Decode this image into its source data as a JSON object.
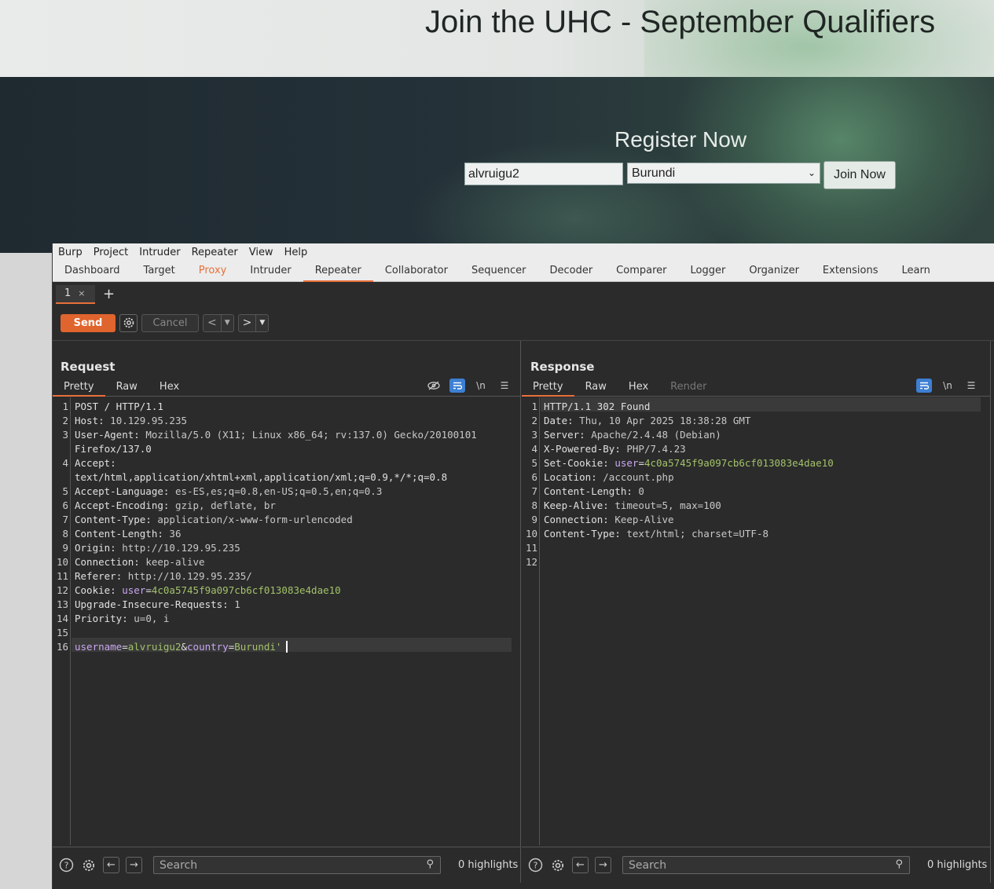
{
  "web": {
    "title": "Join the UHC - September Qualifiers",
    "register_heading": "Register Now",
    "username_value": "alvruigu2",
    "country_selected": "Burundi",
    "join_label": "Join Now"
  },
  "burp": {
    "menu": [
      "Burp",
      "Project",
      "Intruder",
      "Repeater",
      "View",
      "Help"
    ],
    "tabs": [
      "Dashboard",
      "Target",
      "Proxy",
      "Intruder",
      "Repeater",
      "Collaborator",
      "Sequencer",
      "Decoder",
      "Comparer",
      "Logger",
      "Organizer",
      "Extensions",
      "Learn"
    ],
    "active_tab": "Repeater",
    "repeater_tab": "1",
    "repeater_tab_close": "×",
    "add_tab": "+",
    "toolbar": {
      "send": "Send",
      "cancel": "Cancel"
    },
    "request": {
      "title": "Request",
      "view_tabs": [
        "Pretty",
        "Raw",
        "Hex"
      ],
      "lines": [
        "POST / HTTP/1.1",
        "Host: 10.129.95.235",
        "User-Agent: Mozilla/5.0 (X11; Linux x86_64; rv:137.0) Gecko/20100101",
        "Firefox/137.0",
        "Accept:",
        "text/html,application/xhtml+xml,application/xml;q=0.9,*/*;q=0.8",
        "Accept-Language: es-ES,es;q=0.8,en-US;q=0.5,en;q=0.3",
        "Accept-Encoding: gzip, deflate, br",
        "Content-Type: application/x-www-form-urlencoded",
        "Content-Length: 36",
        "Origin: http://10.129.95.235",
        "Connection: keep-alive",
        "Referer: http://10.129.95.235/",
        "Cookie: user=4c0a5745f9a097cb6cf013083e4dae10",
        "Upgrade-Insecure-Requests: 1",
        "Priority: u=0, i",
        "",
        "username=alvruigu2&country=Burundi'"
      ],
      "line_numbers": [
        "1",
        "2",
        "3",
        "",
        "4",
        "",
        "5",
        "6",
        "7",
        "8",
        "9",
        "10",
        "11",
        "12",
        "13",
        "14",
        "15",
        "16"
      ],
      "search_placeholder": "Search",
      "highlights": "0 highlights"
    },
    "response": {
      "title": "Response",
      "view_tabs": [
        "Pretty",
        "Raw",
        "Hex",
        "Render"
      ],
      "lines": [
        "HTTP/1.1 302 Found",
        "Date: Thu, 10 Apr 2025 18:38:28 GMT",
        "Server: Apache/2.4.48 (Debian)",
        "X-Powered-By: PHP/7.4.23",
        "Set-Cookie: user=4c0a5745f9a097cb6cf013083e4dae10",
        "Location: /account.php",
        "Content-Length: 0",
        "Keep-Alive: timeout=5, max=100",
        "Connection: Keep-Alive",
        "Content-Type: text/html; charset=UTF-8",
        "",
        ""
      ],
      "line_numbers": [
        "1",
        "2",
        "3",
        "4",
        "5",
        "6",
        "7",
        "8",
        "9",
        "10",
        "11",
        "12"
      ],
      "search_placeholder": "Search",
      "highlights": "0 highlights"
    },
    "icons": {
      "settings": "gear-icon",
      "help": "help-icon",
      "back": "arrow-left-icon",
      "forward": "arrow-right-icon",
      "search": "magnifier-icon",
      "hide": "eye-slash-icon",
      "wrap": "wrap-icon",
      "newline": "\\n",
      "menu": "hamburger-icon"
    },
    "colors": {
      "accent": "#e8703a",
      "send": "#e0642d",
      "toggle_on": "#3d7fd3"
    }
  }
}
